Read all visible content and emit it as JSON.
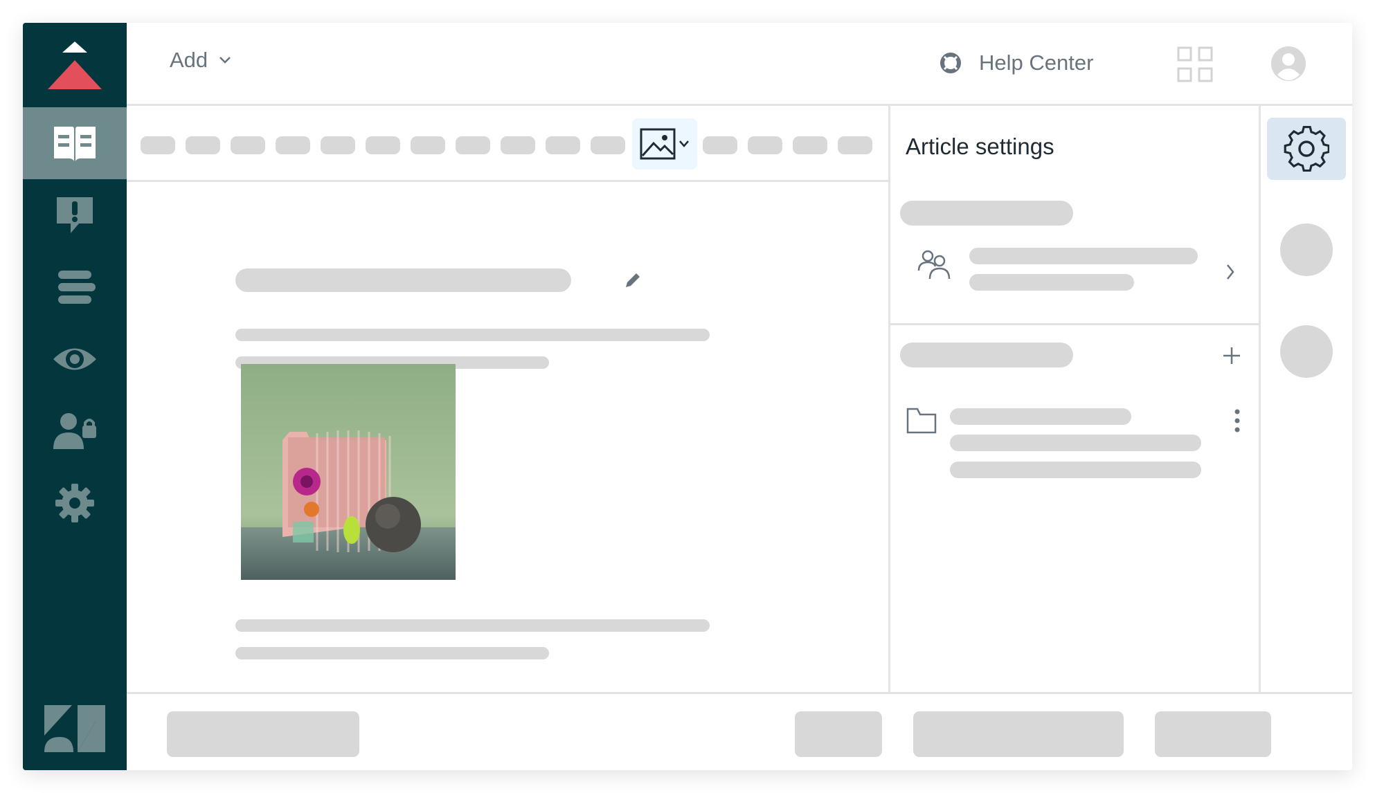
{
  "header": {
    "add_label": "Add",
    "help_label": "Help Center"
  },
  "panel": {
    "title": "Article settings"
  },
  "sidebar": {
    "items": [
      "guide",
      "alerts",
      "list",
      "preview",
      "user-permissions",
      "settings"
    ],
    "active": "guide"
  },
  "colors": {
    "sidebar_bg": "#03363d",
    "active_item_bg": "#6e8a8d",
    "logo_accent": "#e34f5a",
    "placeholder_gray": "#d8d8d8",
    "selected_button_bg": "#dbe6f3"
  }
}
